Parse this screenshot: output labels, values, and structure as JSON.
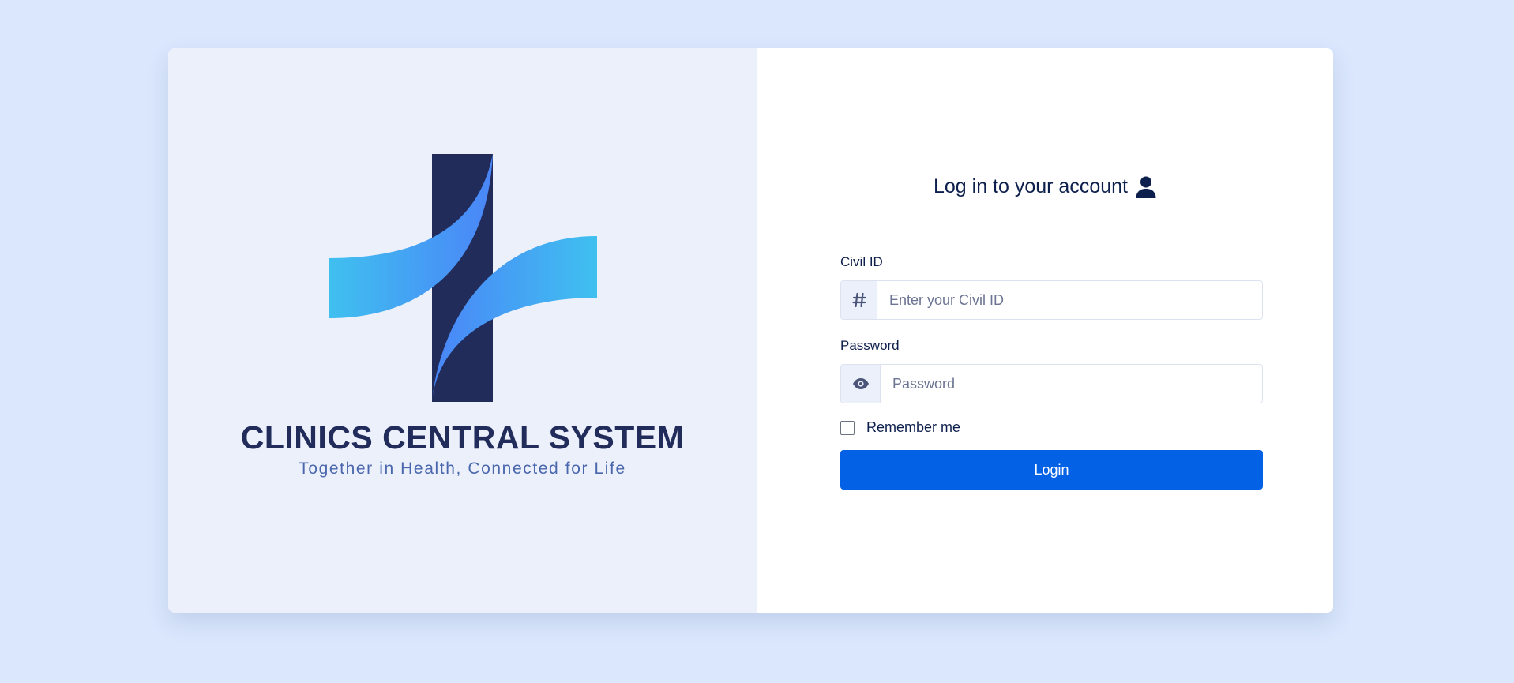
{
  "brand": {
    "title": "CLINICS CENTRAL SYSTEM",
    "tagline": "Together in Health, Connected for Life",
    "colors": {
      "navy": "#212c5b",
      "cyan": "#3fc0ef",
      "blue": "#4a85f8"
    }
  },
  "login": {
    "heading": "Log in to your account",
    "heading_icon": "user-icon",
    "civil_id": {
      "label": "Civil ID",
      "placeholder": "Enter your Civil ID",
      "value": "",
      "icon": "hash-icon"
    },
    "password": {
      "label": "Password",
      "placeholder": "Password",
      "value": "",
      "icon": "eye-icon"
    },
    "remember_me": {
      "label": "Remember me",
      "checked": false
    },
    "submit_label": "Login",
    "accent": "#0361e6"
  }
}
